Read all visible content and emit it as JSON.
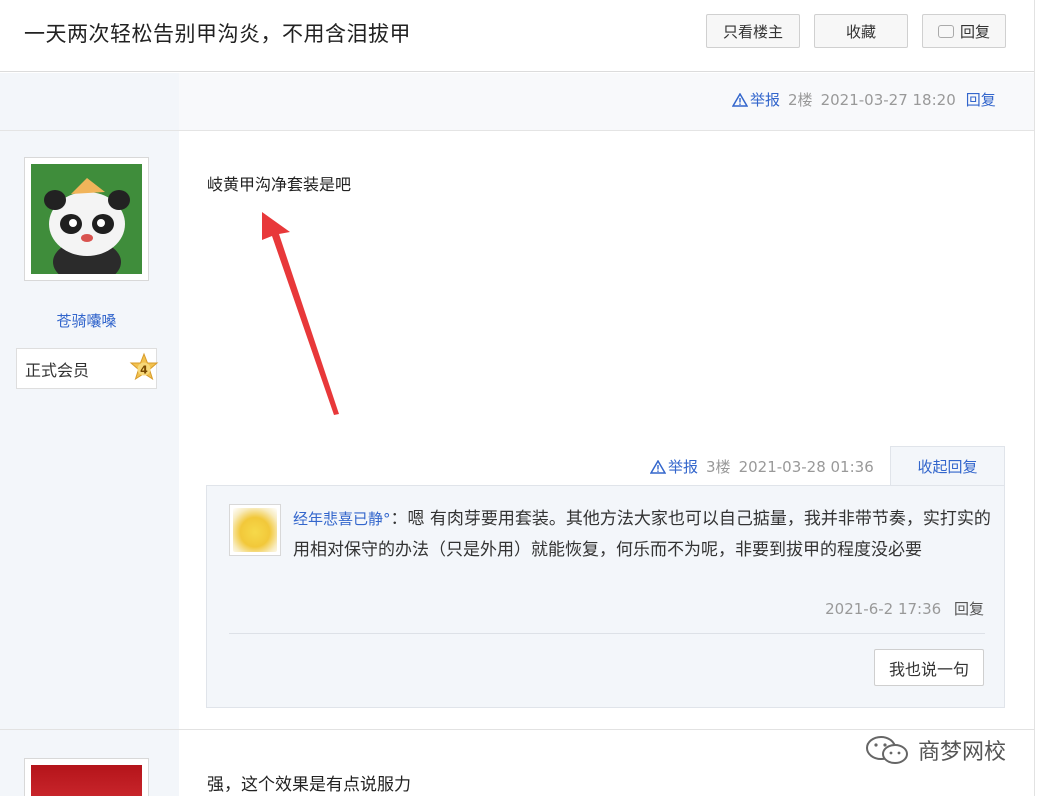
{
  "header": {
    "title": "一天两次轻松告别甲沟炎，不用含泪拔甲",
    "only_op_label": "只看楼主",
    "favorite_label": "收藏",
    "reply_label": "回复"
  },
  "post1_meta": {
    "report_label": "举报",
    "floor": "2楼",
    "time": "2021-03-27 18:20",
    "reply_label": "回复"
  },
  "post2": {
    "username": "苍骑囔嗓",
    "member_level": "正式会员",
    "level_number": "4",
    "content": "岐黄甲沟净套装是吧",
    "meta": {
      "report_label": "举报",
      "floor": "3楼",
      "time": "2021-03-28 01:36",
      "collapse_label": "收起回复"
    },
    "reply": {
      "username": "经年悲喜已静°",
      "text": "：嗯 有肉芽要用套装。其他方法大家也可以自己掂量，我并非带节奏，实打实的用相对保守的办法（只是外用）就能恢复，何乐而不为呢，非要到拔甲的程度没必要",
      "time": "2021-6-2 17:36",
      "reply_label": "回复"
    },
    "say_button_label": "我也说一句"
  },
  "post3": {
    "content": "强，这个效果是有点说服力"
  },
  "watermark": {
    "text": "商梦网校"
  },
  "colors": {
    "link": "#3366cc",
    "sidebar_bg": "#f3f6fa",
    "arrow": "#e8383a"
  }
}
